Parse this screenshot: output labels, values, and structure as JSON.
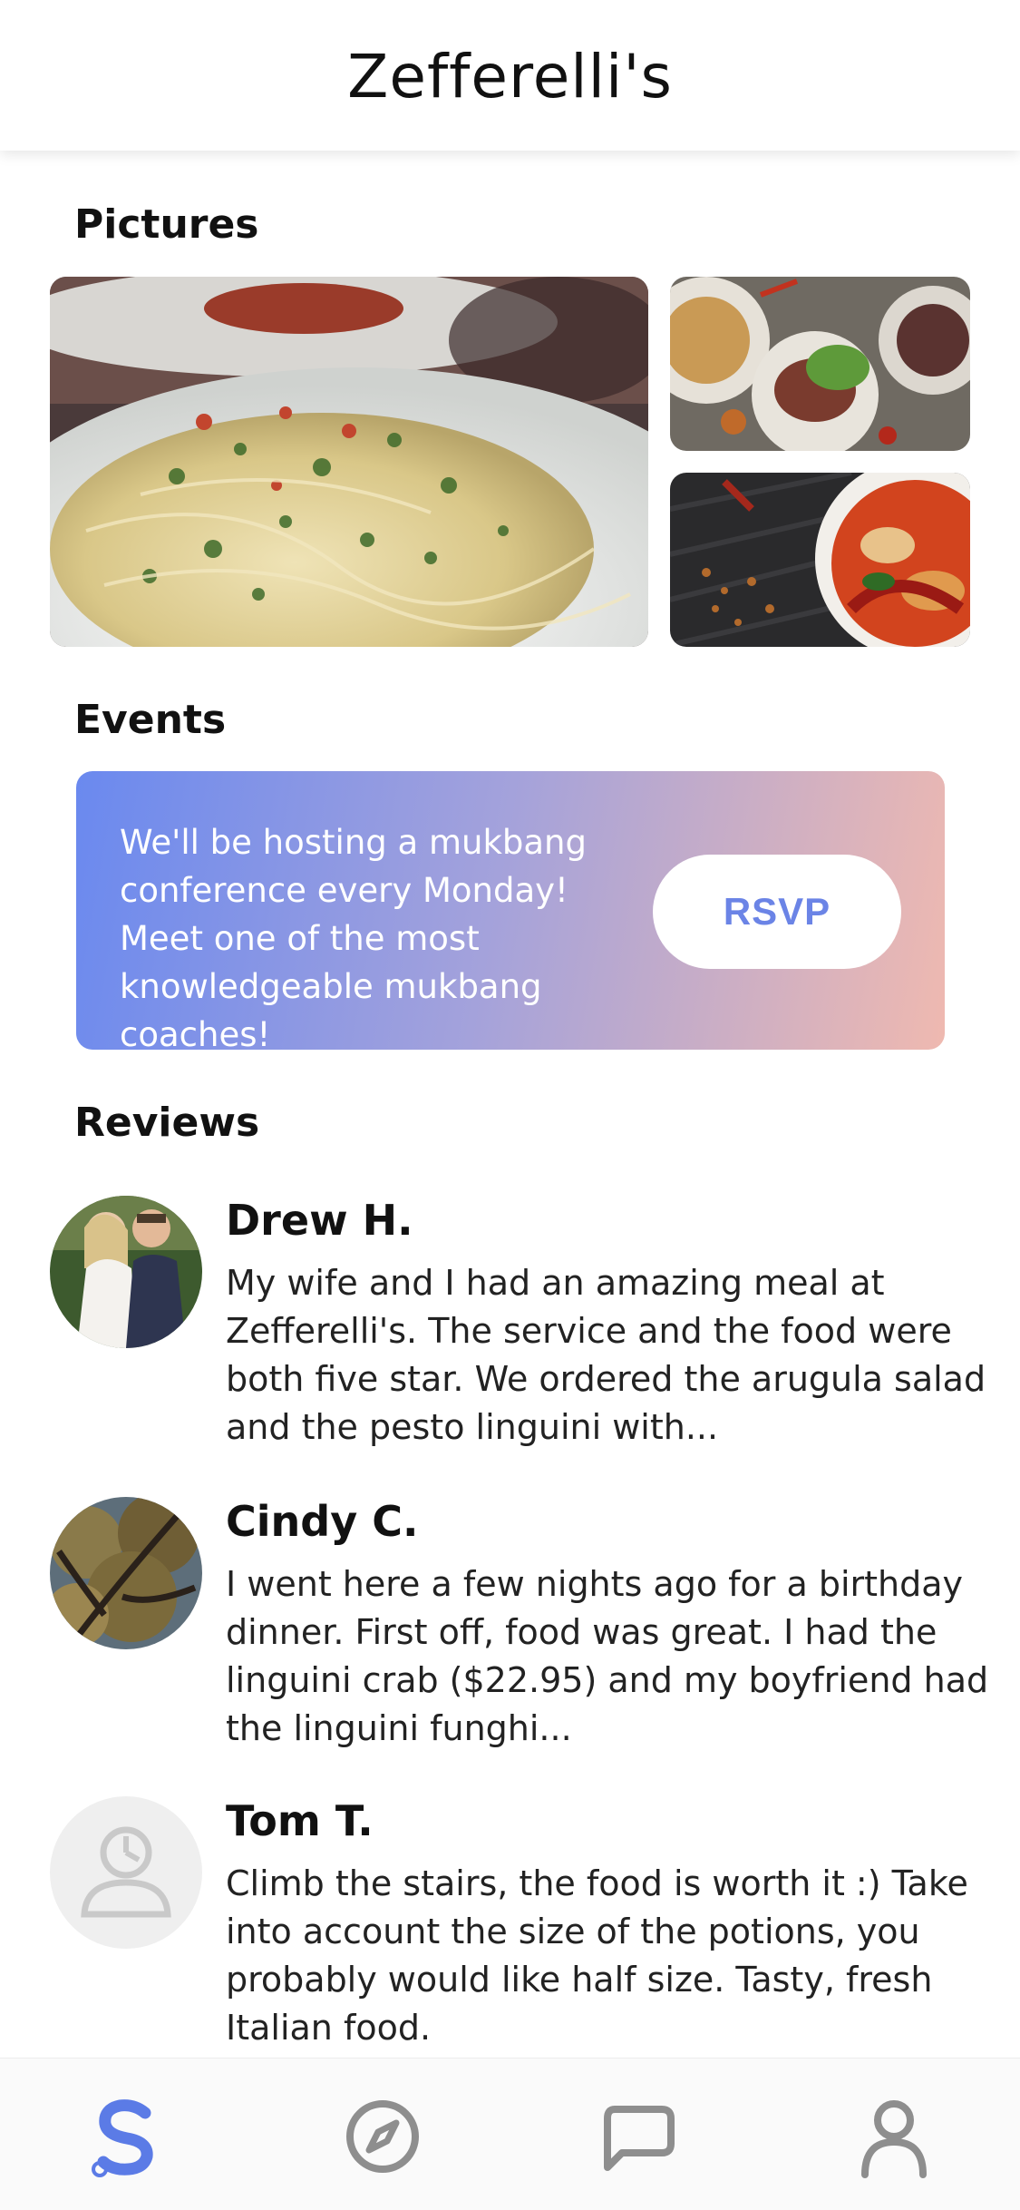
{
  "header": {
    "title": "Zefferelli's"
  },
  "sections": {
    "pictures": "Pictures",
    "events": "Events",
    "reviews": "Reviews"
  },
  "event": {
    "text": "We'll be hosting a mukbang conference every Monday! Meet one of the most knowledgeable mukbang coaches!",
    "button_label": "RSVP"
  },
  "reviews": [
    {
      "name": "Drew H.",
      "text": "My wife and I had an amazing meal at Zefferelli's. The service and the food were both five star. We ordered the arugula salad and the pesto linguini with..."
    },
    {
      "name": "Cindy C.",
      "text": "I went here a few nights ago for a birthday dinner. First off, food was great. I had the linguini crab ($22.95) and my boyfriend had the linguini funghi..."
    },
    {
      "name": "Tom T.",
      "text": "Climb the stairs, the food is worth it :) Take into account the size of the potions, you probably would like half size. Tasty, fresh Italian food."
    }
  ],
  "tabbar": {
    "items": [
      {
        "icon": "brand-s-icon",
        "active": true
      },
      {
        "icon": "compass-icon",
        "active": false
      },
      {
        "icon": "chat-bubble-icon",
        "active": false
      },
      {
        "icon": "profile-icon",
        "active": false
      }
    ]
  },
  "colors": {
    "accent": "#5b7be6",
    "inactive_icon": "#8e8e8e",
    "gradient_start": "#6a89ef",
    "gradient_end": "#efb9b0"
  }
}
